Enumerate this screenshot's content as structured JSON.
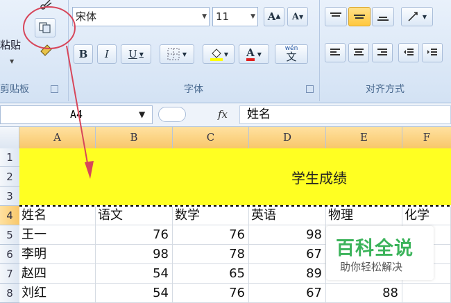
{
  "ribbon": {
    "clipboard": {
      "paste_label": "粘贴",
      "group_label": "剪贴板"
    },
    "font": {
      "font_name": "宋体",
      "font_size": "11",
      "grow_label": "A",
      "shrink_label": "A",
      "bold": "B",
      "italic": "I",
      "underline": "U",
      "font_color_label": "A",
      "phonetic_label": "wén",
      "group_label": "字体"
    },
    "alignment": {
      "group_label": "对齐方式"
    }
  },
  "formula_bar": {
    "name_box": "A4",
    "fx_label": "fx",
    "formula": "姓名"
  },
  "sheet": {
    "columns": [
      "A",
      "B",
      "C",
      "D",
      "E",
      "F"
    ],
    "rows": [
      "1",
      "2",
      "3",
      "4",
      "5",
      "6",
      "7",
      "8"
    ],
    "title": "学生成绩",
    "headers": [
      "姓名",
      "语文",
      "数学",
      "英语",
      "物理",
      "化学"
    ],
    "data": [
      [
        "王一",
        "76",
        "76",
        "98"
      ],
      [
        "李明",
        "98",
        "78",
        "67"
      ],
      [
        "赵四",
        "54",
        "65",
        "89"
      ],
      [
        "刘红",
        "54",
        "76",
        "67",
        "88"
      ]
    ]
  },
  "watermark": {
    "main": "百科全说",
    "sub": "助你轻松解决"
  },
  "colors": {
    "highlight": "#ffff22",
    "annotation": "#d7465a",
    "watermark": "#3bb35a"
  }
}
